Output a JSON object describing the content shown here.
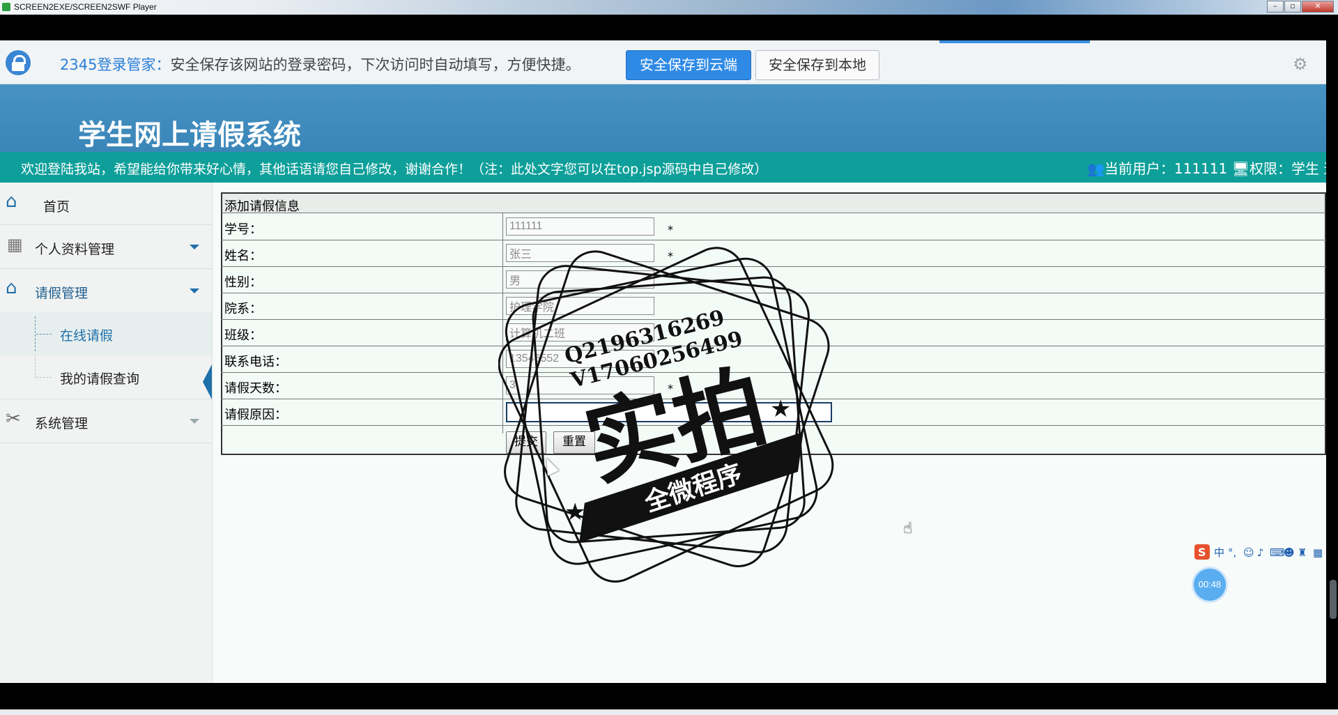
{
  "window": {
    "title": "SCREEN2EXE/SCREEN2SWF Player"
  },
  "password_bar": {
    "brand": "2345登录管家：",
    "message": "安全保存该网站的登录密码，下次访问时自动填写，方便快捷。",
    "save_cloud_label": "安全保存到云端",
    "save_local_label": "安全保存到本地"
  },
  "header": {
    "site_title": "学生网上请假系统",
    "welcome": "欢迎登陆我站，希望能给你带来好心情，其他话语请您自己修改，谢谢合作！（注：此处文字您可以在top.jsp源码中自己修改）",
    "current_user_label": "当前用户：",
    "current_user": "111111",
    "role_label": "权限：",
    "role": "学生",
    "logout_fragment": "退"
  },
  "sidebar": {
    "items": [
      {
        "label": "首页",
        "icon": "home-icon"
      },
      {
        "label": "个人资料管理",
        "icon": "grid-icon"
      },
      {
        "label": "请假管理",
        "icon": "home-icon"
      },
      {
        "label": "系统管理",
        "icon": "tools-icon"
      }
    ],
    "sub_items": [
      {
        "label": "在线请假",
        "active": true
      },
      {
        "label": "我的请假查询",
        "active": false
      }
    ]
  },
  "form": {
    "title": "添加请假信息",
    "fields": [
      {
        "label": "学号：",
        "value": "111111",
        "required": "*"
      },
      {
        "label": "姓名：",
        "value": "张三",
        "required": "*"
      },
      {
        "label": "性别：",
        "value": "男",
        "required": ""
      },
      {
        "label": "院系：",
        "value": "护理学院",
        "required": ""
      },
      {
        "label": "班级：",
        "value": "计算机二班",
        "required": ""
      },
      {
        "label": "联系电话：",
        "value": "13546552",
        "required": ""
      },
      {
        "label": "请假天数：",
        "value": "3",
        "required": "*"
      },
      {
        "label": "请假原因：",
        "value": "",
        "required": ""
      }
    ],
    "submit_label": "提交",
    "reset_label": "重置"
  },
  "watermark": {
    "qq": "Q2196316269",
    "wechat": "V17060256499",
    "big_text": "实拍",
    "ribbon_text": "全微程序"
  },
  "timer": "00:48",
  "colors": {
    "header": "#3a86b8",
    "welcome_bar": "#0e9f9a",
    "accent": "#2f8ae5",
    "active_nav": "#1f6fa8"
  }
}
